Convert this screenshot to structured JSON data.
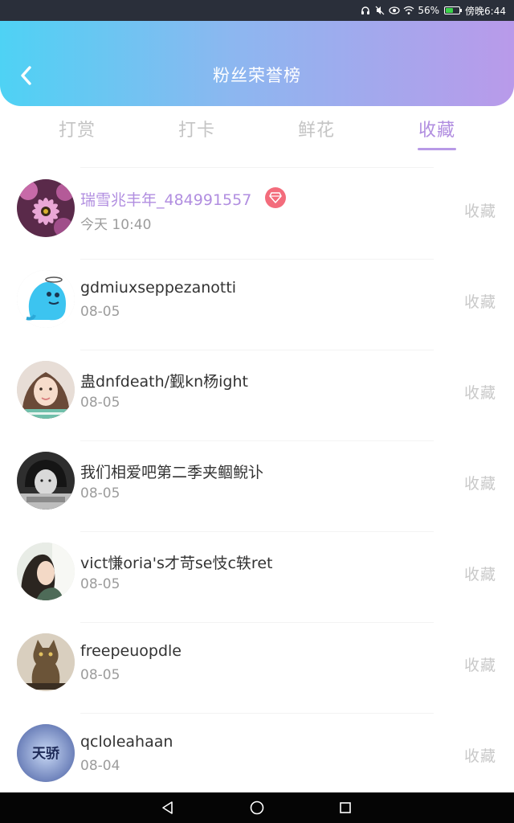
{
  "status_bar": {
    "battery_text": "56%",
    "battery_level": 0.56,
    "time": "傍晚6:44",
    "icons": [
      "headphone-icon",
      "mute-icon",
      "eye-icon",
      "wifi-icon",
      "battery-icon"
    ]
  },
  "header": {
    "title": "粉丝荣誉榜",
    "back_icon": "chevron-left-icon"
  },
  "tabs": [
    {
      "label": "打赏",
      "active": false
    },
    {
      "label": "打卡",
      "active": false
    },
    {
      "label": "鲜花",
      "active": false
    },
    {
      "label": "收藏",
      "active": true
    }
  ],
  "fans": [
    {
      "name": "瑞雪兆丰年_484991557",
      "date": "今天 10:40",
      "action": "收藏",
      "vip": true,
      "avatar": "flower-photo"
    },
    {
      "name": "gdmiuxseppezanotti",
      "date": "08-05",
      "action": "收藏",
      "vip": false,
      "avatar": "blue-cartoon"
    },
    {
      "name": "蛊dnfdeath/觐kn杨ight",
      "date": "08-05",
      "action": "收藏",
      "vip": false,
      "avatar": "girl-photo"
    },
    {
      "name": "我们相爱吧第二季夹鲴鲵讣",
      "date": "08-05",
      "action": "收藏",
      "vip": false,
      "avatar": "bw-portrait"
    },
    {
      "name": "vict慊oria's才苛se忮c轶ret",
      "date": "08-05",
      "action": "收藏",
      "vip": false,
      "avatar": "woman-profile"
    },
    {
      "name": "freepeuopdle",
      "date": "08-05",
      "action": "收藏",
      "vip": false,
      "avatar": "cat-photo"
    },
    {
      "name": "qcloleahaan",
      "date": "08-04",
      "action": "收藏",
      "vip": false,
      "avatar": "tianya-logo",
      "avatar_text": "天骄"
    }
  ],
  "colors": {
    "header_gradient_start": "#4ed2f4",
    "header_gradient_end": "#b99aea",
    "accent": "#b18ee0",
    "vip_badge": "#f36c7c"
  },
  "nav_bar": {
    "icons": [
      "back-triangle-icon",
      "home-circle-icon",
      "recents-square-icon"
    ]
  }
}
